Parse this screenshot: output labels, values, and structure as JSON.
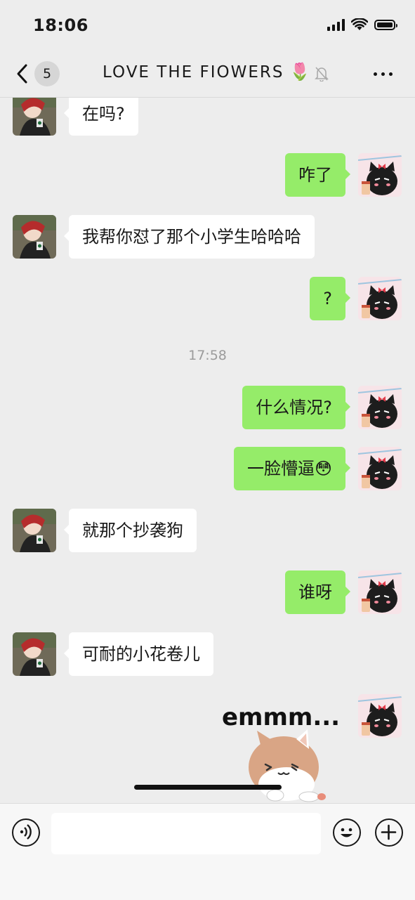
{
  "status_bar": {
    "time": "18:06"
  },
  "nav": {
    "unread_count": "5",
    "title": "LOVE  THE  FIOWERS",
    "title_emoji": "🌷"
  },
  "messages": [
    {
      "side": "in",
      "text": "在吗?"
    },
    {
      "side": "out",
      "text": "咋了"
    },
    {
      "side": "in",
      "text": "我帮你怼了那个小学生哈哈哈"
    },
    {
      "side": "out",
      "text": "?"
    },
    {
      "side": "out",
      "text": "什么情况?"
    },
    {
      "side": "out",
      "text": "一脸懵逼😳"
    },
    {
      "side": "in",
      "text": "就那个抄袭狗"
    },
    {
      "side": "out",
      "text": "谁呀"
    },
    {
      "side": "in",
      "text": "可耐的小花卷儿"
    },
    {
      "side": "out",
      "type": "sticker",
      "text": "emmm..."
    }
  ],
  "timestamp": "17:58",
  "colors": {
    "bg": "#ededed",
    "bubble_out": "#95ec69",
    "bubble_in": "#ffffff"
  }
}
